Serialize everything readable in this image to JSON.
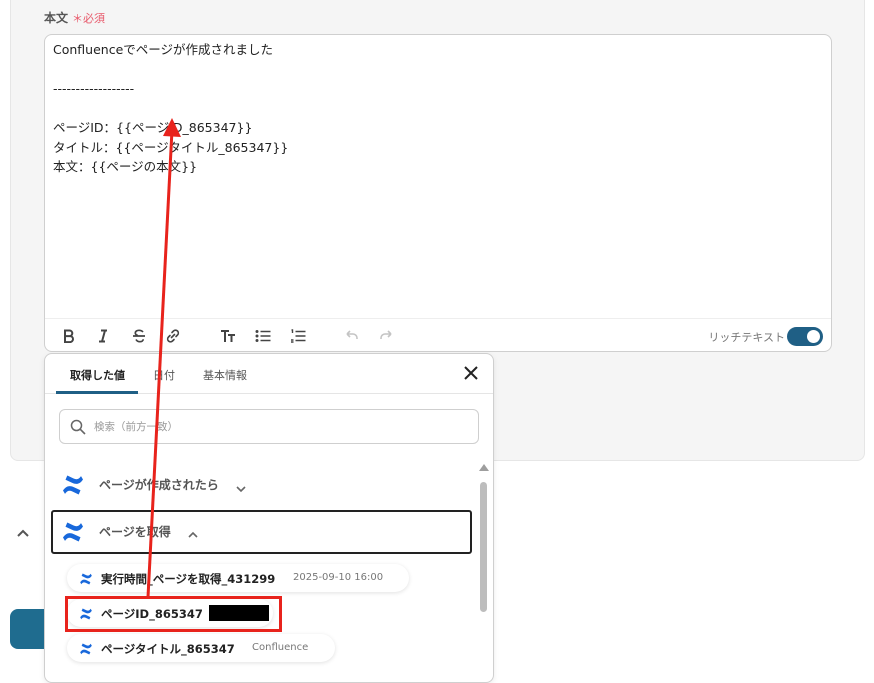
{
  "field": {
    "label": "本文",
    "required_mark": "＊必須"
  },
  "editor": {
    "lines": [
      "Confluenceでページが作成されました",
      "",
      "------------------",
      "",
      "ページID：{{ページID_865347}}",
      "タイトル：{{ページタイトル_865347}}",
      "本文：{{ページの本文}}"
    ],
    "rich_text_label": "リッチテキスト",
    "rich_text_enabled": true
  },
  "toolbar": {
    "icons": [
      "bold-icon",
      "italic-icon",
      "strikethrough-icon",
      "link-icon",
      "text-size-icon",
      "bullet-list-icon",
      "numbered-list-icon",
      "undo-icon",
      "redo-icon"
    ]
  },
  "panel": {
    "tabs": [
      {
        "label": "取得した値",
        "active": true
      },
      {
        "label": "日付",
        "active": false
      },
      {
        "label": "基本情報",
        "active": false
      }
    ],
    "search": {
      "placeholder": "検索（前方一致）"
    },
    "sections": [
      {
        "label": "ページが作成されたら",
        "expanded": false
      },
      {
        "label": "ページを取得",
        "expanded": true
      }
    ],
    "items": [
      {
        "label": "実行時間_ページを取得_431299",
        "value": "2025-09-10 16:00"
      },
      {
        "label": "ページID_865347",
        "value": ""
      },
      {
        "label": "ページタイトル_865347",
        "value": "Confluence"
      }
    ]
  },
  "colors": {
    "accent": "#1f5f85",
    "confluence_blue": "#1868db",
    "annotation_red": "#e8231c"
  }
}
